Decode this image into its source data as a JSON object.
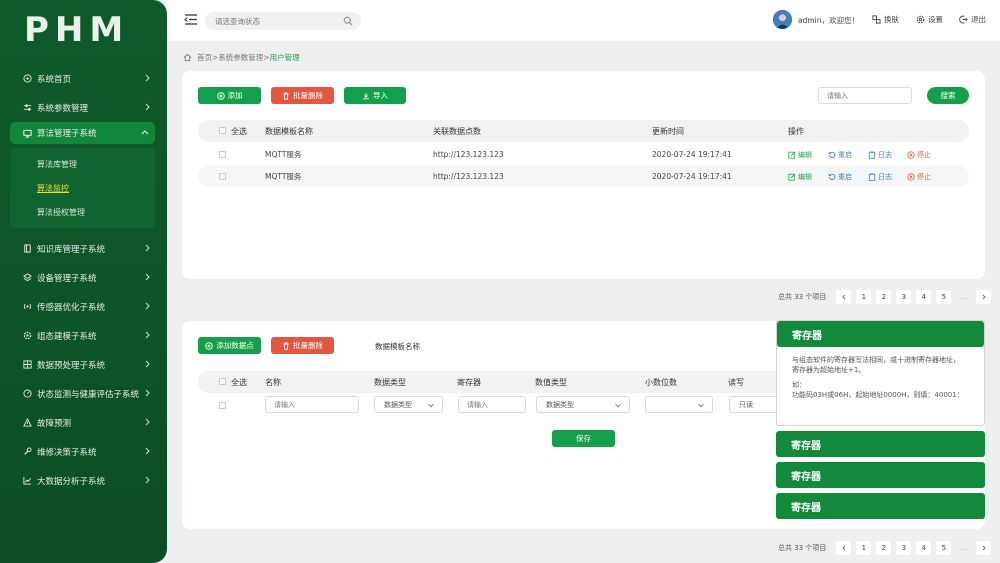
{
  "logo": "PHM",
  "sidebar": {
    "items": [
      {
        "label": "系统首页",
        "icon": "home-icon"
      },
      {
        "label": "系统参数管理",
        "icon": "sliders-icon"
      },
      {
        "label": "算法管理子系统",
        "icon": "monitor-icon",
        "active": true
      },
      {
        "label": "知识库管理子系统",
        "icon": "book-icon"
      },
      {
        "label": "设备管理子系统",
        "icon": "layers-icon"
      },
      {
        "label": "传感器优化子系统",
        "icon": "signal-icon"
      },
      {
        "label": "组态建模子系统",
        "icon": "settings-icon"
      },
      {
        "label": "数据预处理子系统",
        "icon": "grid-icon"
      },
      {
        "label": "状态监测与健康评估子系统",
        "icon": "gauge-icon"
      },
      {
        "label": "故障预测",
        "icon": "warning-icon"
      },
      {
        "label": "维修决策子系统",
        "icon": "wrench-icon"
      },
      {
        "label": "大数据分析子系统",
        "icon": "chart-icon"
      }
    ],
    "sub_items": [
      "算法库管理",
      "算法监控",
      "算法授权管理"
    ]
  },
  "header": {
    "search_placeholder": "请选查询状态",
    "greeting": "admin，欢迎您！",
    "skin": "换肤",
    "settings": "设置",
    "logout": "退出"
  },
  "breadcrumb": {
    "home": "首页",
    "sep": ">",
    "parent": "系统参数管理",
    "current": "用户管理"
  },
  "panel1": {
    "add": "添加",
    "batch_delete": "批量删除",
    "import": "导入",
    "search_placeholder": "请输入",
    "search_button": "搜索",
    "columns": [
      "全选",
      "数据模板名称",
      "关联数据点数",
      "更新时间",
      "操作"
    ],
    "rows": [
      {
        "name": "MQTT服务",
        "url": "http://123.123.123",
        "time": "2020-07-24 19:17:41"
      },
      {
        "name": "MQTT服务",
        "url": "http://123.123.123",
        "time": "2020-07-24 19:17:41"
      }
    ],
    "actions": {
      "edit": "编辑",
      "restart": "重启",
      "log": "日志",
      "stop": "停止"
    },
    "colors": {
      "edit": "#1aa34a",
      "restart": "#3c7ee0",
      "log": "#3c7ee0",
      "stop": "#e35640"
    }
  },
  "pager": {
    "total": "总共 33 个项目",
    "pages": [
      "1",
      "2",
      "3",
      "4",
      "5"
    ],
    "dots": "..."
  },
  "panel2": {
    "add_point": "添加数据点",
    "batch_delete": "批量删除",
    "template_label": "数据模板名称",
    "columns": [
      "全选",
      "名称",
      "数据类型",
      "寄存器",
      "数值类型",
      "小数位数",
      "读写"
    ],
    "name_placeholder": "请输入",
    "data_type": "数据类型",
    "register_placeholder": "请输入",
    "value_type": "数据类型",
    "decimals": "",
    "rw": "只读",
    "save": "保存"
  },
  "register_popup": {
    "title": "寄存器",
    "line1": "与组态软件的寄存器写法相同，或十进制寄存器地址，",
    "line2": "寄存器为超始地址+1。",
    "line3": "如：",
    "line4": "功能码03H或06H，起始地址0000H，则填：40001：",
    "tabs": [
      "寄存器",
      "寄存器",
      "寄存器"
    ]
  },
  "theme": {
    "green": "#14a04a",
    "red": "#e35640",
    "sidebar": "#0d5428"
  }
}
